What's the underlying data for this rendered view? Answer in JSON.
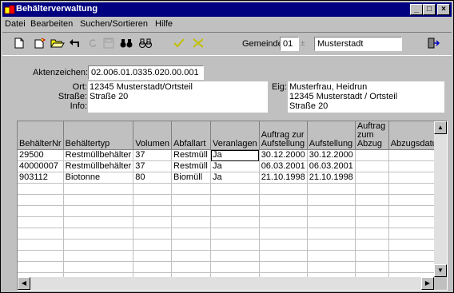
{
  "window": {
    "title": "Behälterverwaltung"
  },
  "titlebar_buttons": {
    "minimize": "_",
    "maximize": "□",
    "close": "×"
  },
  "menu": [
    {
      "label": "Datei"
    },
    {
      "label": "Bearbeiten"
    },
    {
      "label": "Suchen/Sortieren"
    },
    {
      "label": "Hilfe"
    }
  ],
  "toolbar": {
    "gemeinde_label": "Gemeinde:",
    "gemeinde_code": "01",
    "gemeinde_name": "Musterstadt"
  },
  "record": {
    "aktenzeichen_label": "Aktenzeichen:",
    "aktenzeichen": "02.006.01.0335.020.00.001",
    "ort_label": "Ort:",
    "ort": "12345 Musterstadt/Ortsteil",
    "strasse_label": "Straße:",
    "strasse": "Straße 20",
    "info_label": "Info:",
    "info": "",
    "eig_label": "Eig:",
    "eig_lines": [
      "Musterfrau, Heidrun",
      "12345 Musterstadt / Ortsteil",
      "Straße 20"
    ]
  },
  "grid": {
    "columns": [
      "BehälterNr",
      "Behältertyp",
      "Volumen",
      "Abfallart",
      "Veranlagen",
      "Auftrag zur Aufstellung",
      "Aufstellung",
      "Auftrag zum Abzug",
      "Abzugsdatum"
    ],
    "rows": [
      [
        "29500",
        "Restmüllbehälter",
        "37",
        "Restmüll",
        "Ja",
        "30.12.2000",
        "30.12.2000",
        "",
        ""
      ],
      [
        "40000007",
        "Restmüllbehälter",
        "37",
        "Restmüll",
        "Ja",
        "06.03.2001",
        "06.03.2001",
        "",
        ""
      ],
      [
        "903112",
        "Biotonne",
        "80",
        "Biomüll",
        "Ja",
        "21.10.1998",
        "21.10.1998",
        "",
        ""
      ]
    ],
    "empty_rows": 9
  }
}
